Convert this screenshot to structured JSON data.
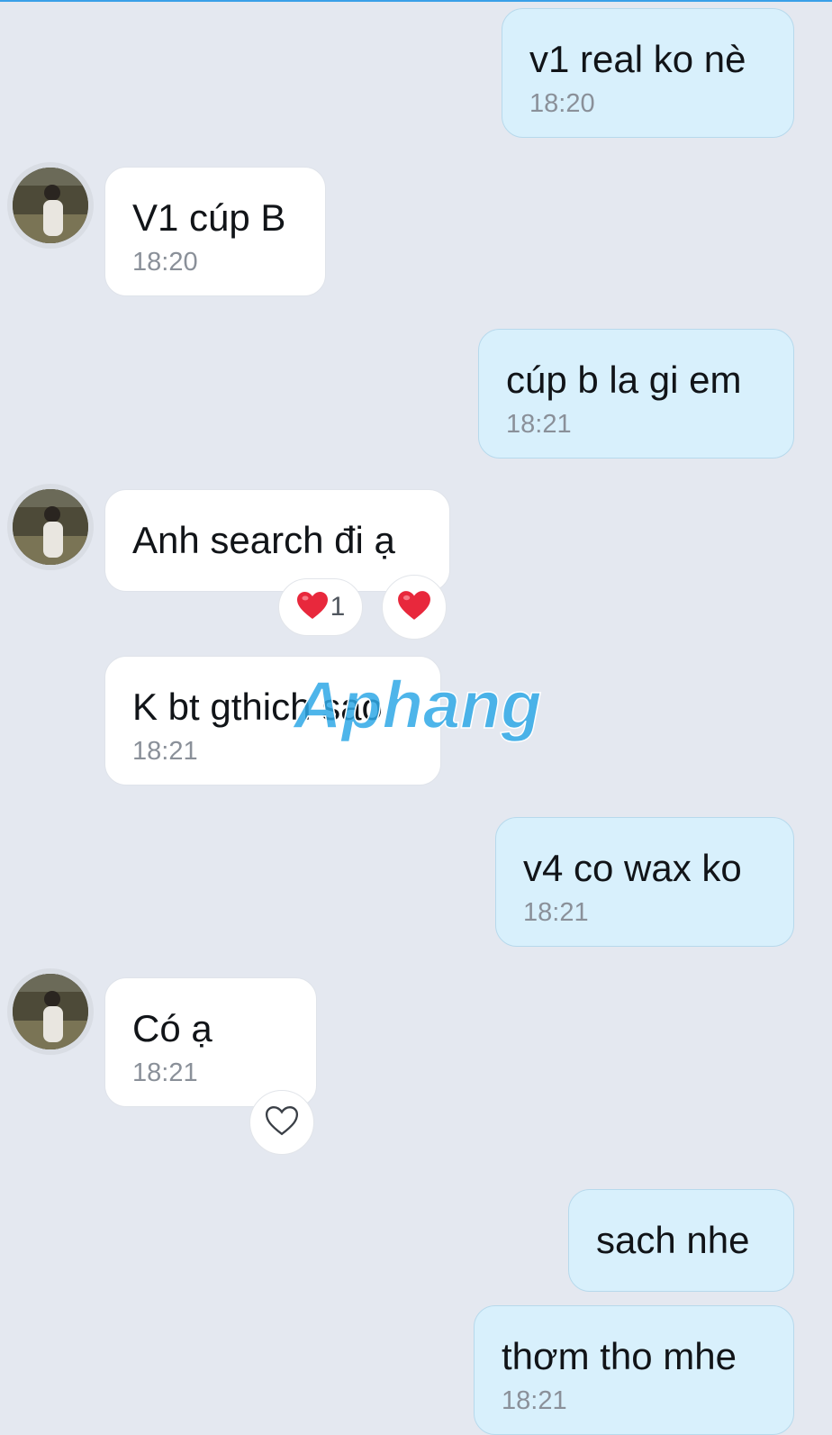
{
  "messages": [
    {
      "text": "v1 real ko nè",
      "time": "18:20"
    },
    {
      "text": "V1 cúp B",
      "time": "18:20"
    },
    {
      "text": "cúp b la gi em",
      "time": "18:21"
    },
    {
      "text": "Anh search đi ạ"
    },
    {
      "text": "K bt gthich sao",
      "time": "18:21"
    },
    {
      "text": "v4 co wax ko",
      "time": "18:21"
    },
    {
      "text": "Có ạ",
      "time": "18:21"
    },
    {
      "text": "sach nhe"
    },
    {
      "text": "thơm tho mhe",
      "time": "18:21"
    }
  ],
  "reactions": {
    "heart_count": "1"
  },
  "icons": {
    "reaction": "heart-icon",
    "add_reaction": "heart-outline-icon"
  },
  "watermark": {
    "text": "Aphang"
  },
  "colors": {
    "background": "#e4e8f0",
    "outgoing_bubble": "#d8f0fc",
    "incoming_bubble": "#ffffff",
    "heart": "#e8283c",
    "accent_line": "#3aa0e8"
  }
}
